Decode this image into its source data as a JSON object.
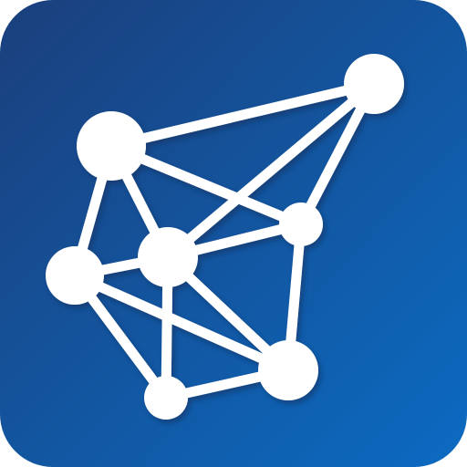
{
  "icon": {
    "name": "network-graph-icon",
    "colors": {
      "background_start": "#1B3F7C",
      "background_end": "#0B6BC2",
      "foreground": "#FFFFFF",
      "shadow": "#0A2E5C"
    }
  }
}
